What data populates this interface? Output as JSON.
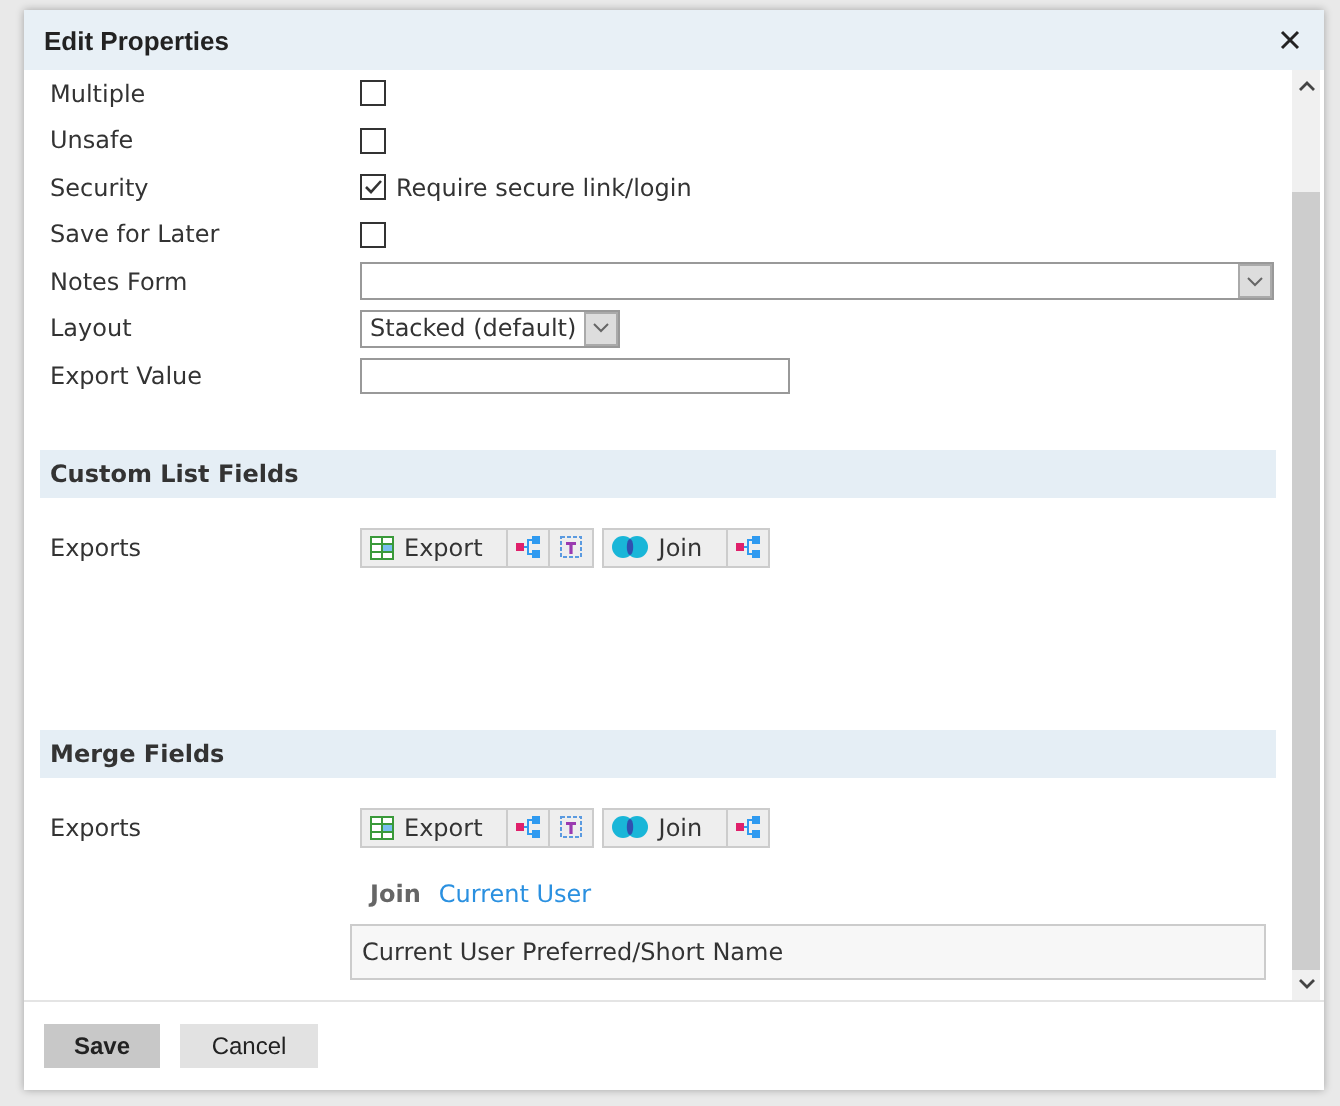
{
  "dialog": {
    "title": "Edit Properties"
  },
  "fields": [
    {
      "kind": "checkbox",
      "label": "Multiple",
      "checked": false
    },
    {
      "kind": "checkbox",
      "label": "Unsafe",
      "checked": false
    },
    {
      "kind": "checkbox",
      "label": "Security",
      "checked": true,
      "text": "Require secure link/login"
    },
    {
      "kind": "checkbox",
      "label": "Save for Later",
      "checked": false
    },
    {
      "kind": "select-wide",
      "label": "Notes Form"
    },
    {
      "kind": "select",
      "label": "Layout",
      "value": "Stacked (default)"
    },
    {
      "kind": "text",
      "label": "Export Value"
    }
  ],
  "sections": [
    {
      "title": "Custom List Fields",
      "label": "Exports",
      "tools": [
        {
          "kind": "export",
          "label": "Export"
        },
        {
          "kind": "join",
          "label": "Join"
        }
      ]
    },
    {
      "title": "Merge Fields",
      "label": "Exports",
      "tools": [
        {
          "kind": "export",
          "label": "Export"
        },
        {
          "kind": "join",
          "label": "Join"
        }
      ],
      "join": {
        "label": "Join",
        "link": "Current User"
      },
      "value": "Current User Preferred/Short Name"
    }
  ],
  "buttons": [
    {
      "kind": "primary",
      "label": "Save"
    },
    {
      "kind": "secondary",
      "label": "Cancel"
    }
  ]
}
